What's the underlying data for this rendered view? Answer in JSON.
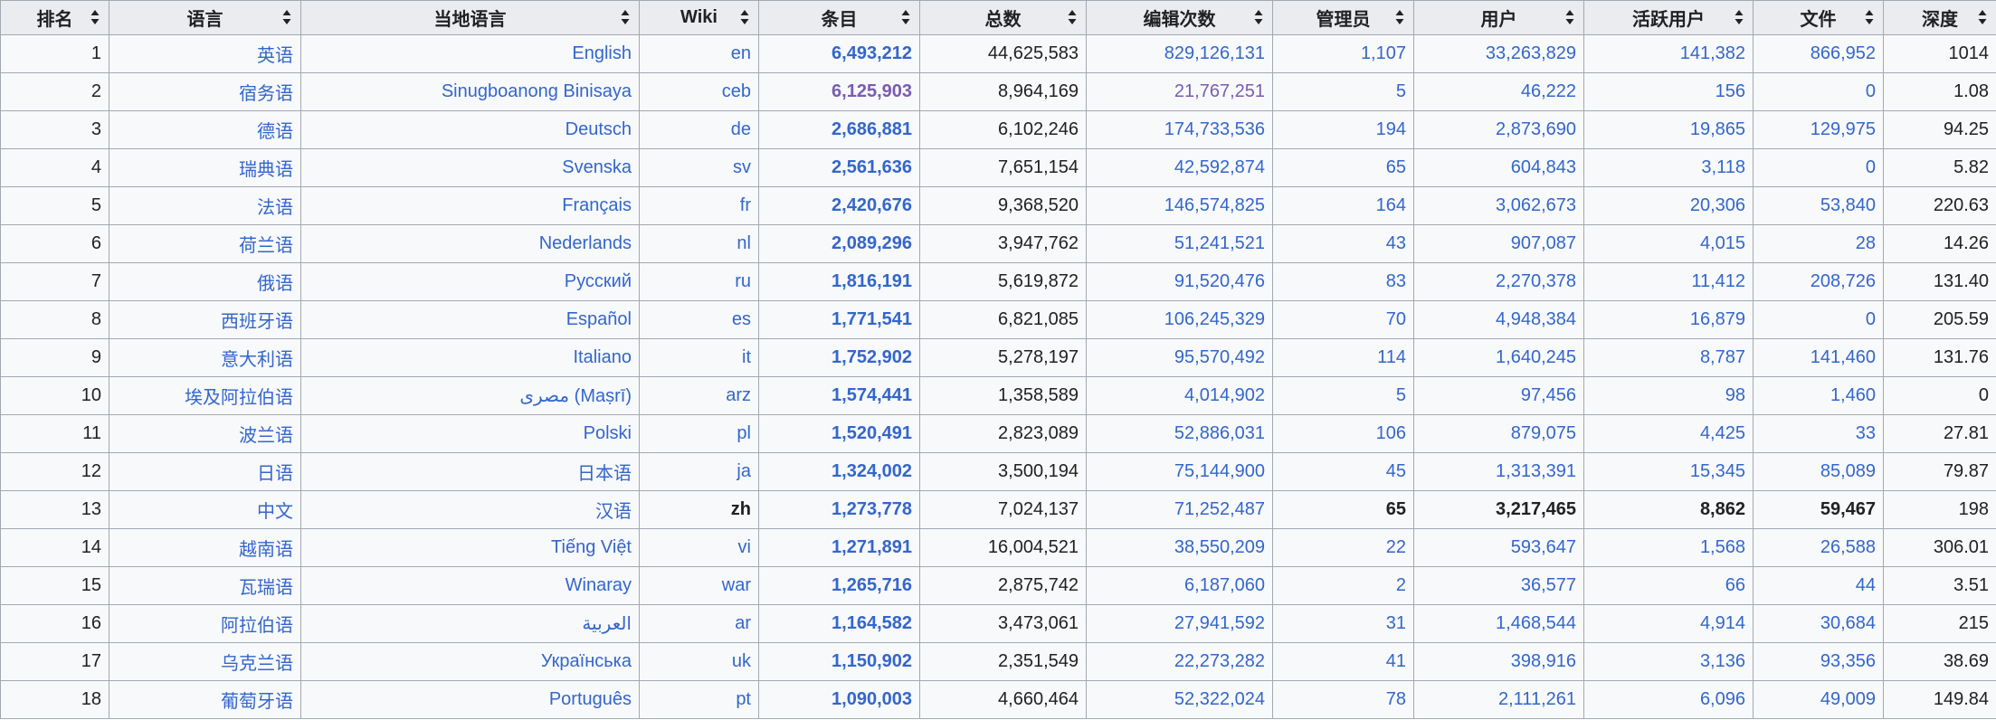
{
  "colors": {
    "header_bg": "#eaecf0",
    "cell_bg": "#f8f9fa",
    "border": "#a2a9b1",
    "link": "#3366cc",
    "visited_link": "#795cb2",
    "text": "#202122"
  },
  "table": {
    "headers": [
      {
        "label": "排名",
        "icon": "sort-icon"
      },
      {
        "label": "语言",
        "icon": "sort-icon"
      },
      {
        "label": "当地语言",
        "icon": "sort-icon"
      },
      {
        "label": "Wiki",
        "icon": "sort-icon"
      },
      {
        "label": "条目",
        "icon": "sort-icon"
      },
      {
        "label": "总数",
        "icon": "sort-icon"
      },
      {
        "label": "编辑次数",
        "icon": "sort-icon"
      },
      {
        "label": "管理员",
        "icon": "sort-icon"
      },
      {
        "label": "用户",
        "icon": "sort-icon"
      },
      {
        "label": "活跃用户",
        "icon": "sort-icon"
      },
      {
        "label": "文件",
        "icon": "sort-icon"
      },
      {
        "label": "深度",
        "icon": "sort-icon"
      }
    ],
    "rows": [
      {
        "rank": "1",
        "language": "英语",
        "local": "English",
        "wiki": "en",
        "articles": "6,493,212",
        "total": "44,625,583",
        "edits": "829,126,131",
        "admins": "1,107",
        "users": "33,263,829",
        "active": "141,382",
        "files": "866,952",
        "depth": "1014"
      },
      {
        "rank": "2",
        "language": "宿务语",
        "local": "Sinugboanong Binisaya",
        "wiki": "ceb",
        "articles": "6,125,903",
        "total": "8,964,169",
        "edits": "21,767,251",
        "admins": "5",
        "users": "46,222",
        "active": "156",
        "files": "0",
        "depth": "1.08",
        "visited": true
      },
      {
        "rank": "3",
        "language": "德语",
        "local": "Deutsch",
        "wiki": "de",
        "articles": "2,686,881",
        "total": "6,102,246",
        "edits": "174,733,536",
        "admins": "194",
        "users": "2,873,690",
        "active": "19,865",
        "files": "129,975",
        "depth": "94.25"
      },
      {
        "rank": "4",
        "language": "瑞典语",
        "local": "Svenska",
        "wiki": "sv",
        "articles": "2,561,636",
        "total": "7,651,154",
        "edits": "42,592,874",
        "admins": "65",
        "users": "604,843",
        "active": "3,118",
        "files": "0",
        "depth": "5.82"
      },
      {
        "rank": "5",
        "language": "法语",
        "local": "Français",
        "wiki": "fr",
        "articles": "2,420,676",
        "total": "9,368,520",
        "edits": "146,574,825",
        "admins": "164",
        "users": "3,062,673",
        "active": "20,306",
        "files": "53,840",
        "depth": "220.63"
      },
      {
        "rank": "6",
        "language": "荷兰语",
        "local": "Nederlands",
        "wiki": "nl",
        "articles": "2,089,296",
        "total": "3,947,762",
        "edits": "51,241,521",
        "admins": "43",
        "users": "907,087",
        "active": "4,015",
        "files": "28",
        "depth": "14.26"
      },
      {
        "rank": "7",
        "language": "俄语",
        "local": "Русский",
        "wiki": "ru",
        "articles": "1,816,191",
        "total": "5,619,872",
        "edits": "91,520,476",
        "admins": "83",
        "users": "2,270,378",
        "active": "11,412",
        "files": "208,726",
        "depth": "131.40"
      },
      {
        "rank": "8",
        "language": "西班牙语",
        "local": "Español",
        "wiki": "es",
        "articles": "1,771,541",
        "total": "6,821,085",
        "edits": "106,245,329",
        "admins": "70",
        "users": "4,948,384",
        "active": "16,879",
        "files": "0",
        "depth": "205.59"
      },
      {
        "rank": "9",
        "language": "意大利语",
        "local": "Italiano",
        "wiki": "it",
        "articles": "1,752,902",
        "total": "5,278,197",
        "edits": "95,570,492",
        "admins": "114",
        "users": "1,640,245",
        "active": "8,787",
        "files": "141,460",
        "depth": "131.76"
      },
      {
        "rank": "10",
        "language": "埃及阿拉伯语",
        "local": "مصرى (Maṣrī)",
        "wiki": "arz",
        "articles": "1,574,441",
        "total": "1,358,589",
        "edits": "4,014,902",
        "admins": "5",
        "users": "97,456",
        "active": "98",
        "files": "1,460",
        "depth": "0"
      },
      {
        "rank": "11",
        "language": "波兰语",
        "local": "Polski",
        "wiki": "pl",
        "articles": "1,520,491",
        "total": "2,823,089",
        "edits": "52,886,031",
        "admins": "106",
        "users": "879,075",
        "active": "4,425",
        "files": "33",
        "depth": "27.81"
      },
      {
        "rank": "12",
        "language": "日语",
        "local": "日本语",
        "wiki": "ja",
        "articles": "1,324,002",
        "total": "3,500,194",
        "edits": "75,144,900",
        "admins": "45",
        "users": "1,313,391",
        "active": "15,345",
        "files": "85,089",
        "depth": "79.87"
      },
      {
        "rank": "13",
        "language": "中文",
        "local": "汉语",
        "wiki": "zh",
        "articles": "1,273,778",
        "total": "7,024,137",
        "edits": "71,252,487",
        "admins": "65",
        "users": "3,217,465",
        "active": "8,862",
        "files": "59,467",
        "depth": "198",
        "current": true
      },
      {
        "rank": "14",
        "language": "越南语",
        "local": "Tiếng Việt",
        "wiki": "vi",
        "articles": "1,271,891",
        "total": "16,004,521",
        "edits": "38,550,209",
        "admins": "22",
        "users": "593,647",
        "active": "1,568",
        "files": "26,588",
        "depth": "306.01"
      },
      {
        "rank": "15",
        "language": "瓦瑞语",
        "local": "Winaray",
        "wiki": "war",
        "articles": "1,265,716",
        "total": "2,875,742",
        "edits": "6,187,060",
        "admins": "2",
        "users": "36,577",
        "active": "66",
        "files": "44",
        "depth": "3.51"
      },
      {
        "rank": "16",
        "language": "阿拉伯语",
        "local": "العربية",
        "wiki": "ar",
        "articles": "1,164,582",
        "total": "3,473,061",
        "edits": "27,941,592",
        "admins": "31",
        "users": "1,468,544",
        "active": "4,914",
        "files": "30,684",
        "depth": "215"
      },
      {
        "rank": "17",
        "language": "乌克兰语",
        "local": "Українська",
        "wiki": "uk",
        "articles": "1,150,902",
        "total": "2,351,549",
        "edits": "22,273,282",
        "admins": "41",
        "users": "398,916",
        "active": "3,136",
        "files": "93,356",
        "depth": "38.69"
      },
      {
        "rank": "18",
        "language": "葡萄牙语",
        "local": "Português",
        "wiki": "pt",
        "articles": "1,090,003",
        "total": "4,660,464",
        "edits": "52,322,024",
        "admins": "78",
        "users": "2,111,261",
        "active": "6,096",
        "files": "49,009",
        "depth": "149.84"
      }
    ]
  }
}
